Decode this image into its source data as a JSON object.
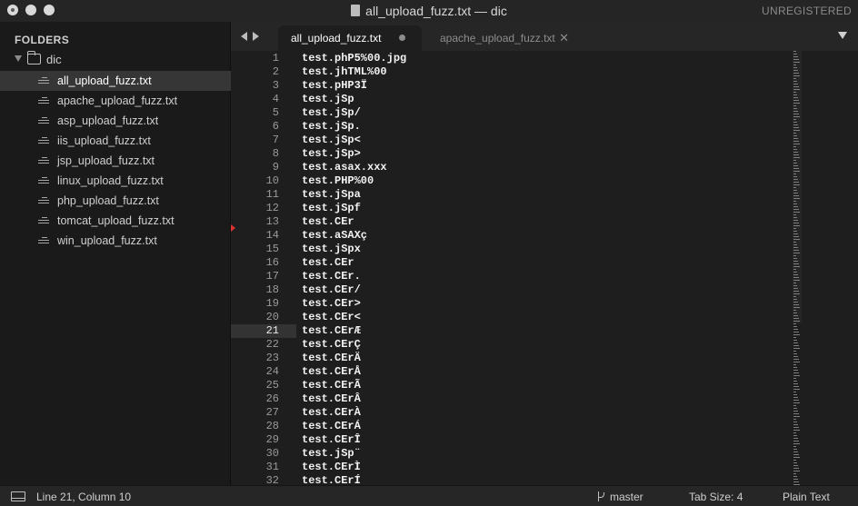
{
  "window": {
    "title": "all_upload_fuzz.txt — dic",
    "license": "UNREGISTERED"
  },
  "sidebar": {
    "header": "FOLDERS",
    "folder": "dic",
    "files": [
      {
        "label": "all_upload_fuzz.txt",
        "selected": true
      },
      {
        "label": "apache_upload_fuzz.txt",
        "selected": false
      },
      {
        "label": "asp_upload_fuzz.txt",
        "selected": false
      },
      {
        "label": "iis_upload_fuzz.txt",
        "selected": false
      },
      {
        "label": "jsp_upload_fuzz.txt",
        "selected": false
      },
      {
        "label": "linux_upload_fuzz.txt",
        "selected": false
      },
      {
        "label": "php_upload_fuzz.txt",
        "selected": false
      },
      {
        "label": "tomcat_upload_fuzz.txt",
        "selected": false
      },
      {
        "label": "win_upload_fuzz.txt",
        "selected": false
      }
    ]
  },
  "tabs": [
    {
      "label": "all_upload_fuzz.txt",
      "active": true,
      "modified": true
    },
    {
      "label": "apache_upload_fuzz.txt",
      "active": false,
      "modified": false
    }
  ],
  "editor": {
    "current_line": 21,
    "lines": [
      {
        "n": "1",
        "text": "test.phP5%00.jpg"
      },
      {
        "n": "2",
        "text": "test.jhTML%00"
      },
      {
        "n": "3",
        "text": "test.pHP3Ï"
      },
      {
        "n": "4",
        "text": "test.jSp"
      },
      {
        "n": "5",
        "text": "test.jSp/"
      },
      {
        "n": "6",
        "text": "test.jSp."
      },
      {
        "n": "7",
        "text": "test.jSp<"
      },
      {
        "n": "8",
        "text": "test.jSp>"
      },
      {
        "n": "9",
        "text": "test.asax.xxx"
      },
      {
        "n": "10",
        "text": "test.PHP%00"
      },
      {
        "n": "11",
        "text": "test.jSpa"
      },
      {
        "n": "12",
        "text": "test.jSpf"
      },
      {
        "n": "13",
        "text": "test.CEr"
      },
      {
        "n": "14",
        "text": "test.aSAXç"
      },
      {
        "n": "15",
        "text": "test.jSpx"
      },
      {
        "n": "16",
        "text": "test.CEr"
      },
      {
        "n": "17",
        "text": "test.CEr."
      },
      {
        "n": "18",
        "text": "test.CEr/"
      },
      {
        "n": "19",
        "text": "test.CEr>"
      },
      {
        "n": "20",
        "text": "test.CEr<"
      },
      {
        "n": "21",
        "text": "test.CErÆ"
      },
      {
        "n": "22",
        "text": "test.CErÇ"
      },
      {
        "n": "23",
        "text": "test.CErÄ"
      },
      {
        "n": "24",
        "text": "test.CErÅ"
      },
      {
        "n": "25",
        "text": "test.CErÃ"
      },
      {
        "n": "26",
        "text": "test.CErÂ"
      },
      {
        "n": "27",
        "text": "test.CErÀ"
      },
      {
        "n": "28",
        "text": "test.CErÁ"
      },
      {
        "n": "29",
        "text": "test.CErÎ"
      },
      {
        "n": "30",
        "text": "test.jSp¨"
      },
      {
        "n": "31",
        "text": "test.CErÌ"
      },
      {
        "n": "32",
        "text": "test.CErÍ"
      }
    ]
  },
  "status": {
    "position": "Line 21, Column 10",
    "branch": "master",
    "tab_size": "Tab Size: 4",
    "syntax": "Plain Text"
  }
}
